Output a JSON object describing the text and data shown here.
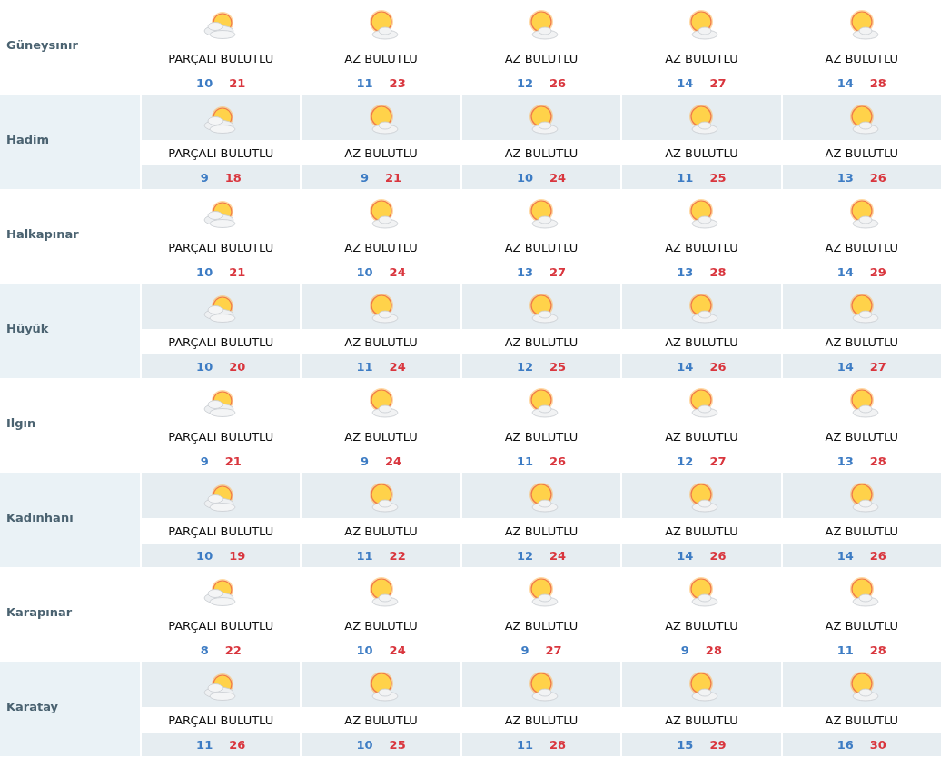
{
  "rows": [
    {
      "place": "Güneysınır",
      "days": [
        {
          "kind": "partly",
          "condition": "PARÇALI BULUTLU",
          "low": "10",
          "high": "21"
        },
        {
          "kind": "few",
          "condition": "AZ BULUTLU",
          "low": "11",
          "high": "23"
        },
        {
          "kind": "few",
          "condition": "AZ BULUTLU",
          "low": "12",
          "high": "26"
        },
        {
          "kind": "few",
          "condition": "AZ BULUTLU",
          "low": "14",
          "high": "27"
        },
        {
          "kind": "few",
          "condition": "AZ BULUTLU",
          "low": "14",
          "high": "28"
        }
      ]
    },
    {
      "place": "Hadim",
      "days": [
        {
          "kind": "partly",
          "condition": "PARÇALI BULUTLU",
          "low": "9",
          "high": "18"
        },
        {
          "kind": "few",
          "condition": "AZ BULUTLU",
          "low": "9",
          "high": "21"
        },
        {
          "kind": "few",
          "condition": "AZ BULUTLU",
          "low": "10",
          "high": "24"
        },
        {
          "kind": "few",
          "condition": "AZ BULUTLU",
          "low": "11",
          "high": "25"
        },
        {
          "kind": "few",
          "condition": "AZ BULUTLU",
          "low": "13",
          "high": "26"
        }
      ]
    },
    {
      "place": "Halkapınar",
      "days": [
        {
          "kind": "partly",
          "condition": "PARÇALI BULUTLU",
          "low": "10",
          "high": "21"
        },
        {
          "kind": "few",
          "condition": "AZ BULUTLU",
          "low": "10",
          "high": "24"
        },
        {
          "kind": "few",
          "condition": "AZ BULUTLU",
          "low": "13",
          "high": "27"
        },
        {
          "kind": "few",
          "condition": "AZ BULUTLU",
          "low": "13",
          "high": "28"
        },
        {
          "kind": "few",
          "condition": "AZ BULUTLU",
          "low": "14",
          "high": "29"
        }
      ]
    },
    {
      "place": "Hüyük",
      "days": [
        {
          "kind": "partly",
          "condition": "PARÇALI BULUTLU",
          "low": "10",
          "high": "20"
        },
        {
          "kind": "few",
          "condition": "AZ BULUTLU",
          "low": "11",
          "high": "24"
        },
        {
          "kind": "few",
          "condition": "AZ BULUTLU",
          "low": "12",
          "high": "25"
        },
        {
          "kind": "few",
          "condition": "AZ BULUTLU",
          "low": "14",
          "high": "26"
        },
        {
          "kind": "few",
          "condition": "AZ BULUTLU",
          "low": "14",
          "high": "27"
        }
      ]
    },
    {
      "place": "Ilgın",
      "days": [
        {
          "kind": "partly",
          "condition": "PARÇALI BULUTLU",
          "low": "9",
          "high": "21"
        },
        {
          "kind": "few",
          "condition": "AZ BULUTLU",
          "low": "9",
          "high": "24"
        },
        {
          "kind": "few",
          "condition": "AZ BULUTLU",
          "low": "11",
          "high": "26"
        },
        {
          "kind": "few",
          "condition": "AZ BULUTLU",
          "low": "12",
          "high": "27"
        },
        {
          "kind": "few",
          "condition": "AZ BULUTLU",
          "low": "13",
          "high": "28"
        }
      ]
    },
    {
      "place": "Kadınhanı",
      "days": [
        {
          "kind": "partly",
          "condition": "PARÇALI BULUTLU",
          "low": "10",
          "high": "19"
        },
        {
          "kind": "few",
          "condition": "AZ BULUTLU",
          "low": "11",
          "high": "22"
        },
        {
          "kind": "few",
          "condition": "AZ BULUTLU",
          "low": "12",
          "high": "24"
        },
        {
          "kind": "few",
          "condition": "AZ BULUTLU",
          "low": "14",
          "high": "26"
        },
        {
          "kind": "few",
          "condition": "AZ BULUTLU",
          "low": "14",
          "high": "26"
        }
      ]
    },
    {
      "place": "Karapınar",
      "days": [
        {
          "kind": "partly",
          "condition": "PARÇALI BULUTLU",
          "low": "8",
          "high": "22"
        },
        {
          "kind": "few",
          "condition": "AZ BULUTLU",
          "low": "10",
          "high": "24"
        },
        {
          "kind": "few",
          "condition": "AZ BULUTLU",
          "low": "9",
          "high": "27"
        },
        {
          "kind": "few",
          "condition": "AZ BULUTLU",
          "low": "9",
          "high": "28"
        },
        {
          "kind": "few",
          "condition": "AZ BULUTLU",
          "low": "11",
          "high": "28"
        }
      ]
    },
    {
      "place": "Karatay",
      "days": [
        {
          "kind": "partly",
          "condition": "PARÇALI BULUTLU",
          "low": "11",
          "high": "26"
        },
        {
          "kind": "few",
          "condition": "AZ BULUTLU",
          "low": "10",
          "high": "25"
        },
        {
          "kind": "few",
          "condition": "AZ BULUTLU",
          "low": "11",
          "high": "28"
        },
        {
          "kind": "few",
          "condition": "AZ BULUTLU",
          "low": "15",
          "high": "29"
        },
        {
          "kind": "few",
          "condition": "AZ BULUTLU",
          "low": "16",
          "high": "30"
        }
      ]
    }
  ]
}
